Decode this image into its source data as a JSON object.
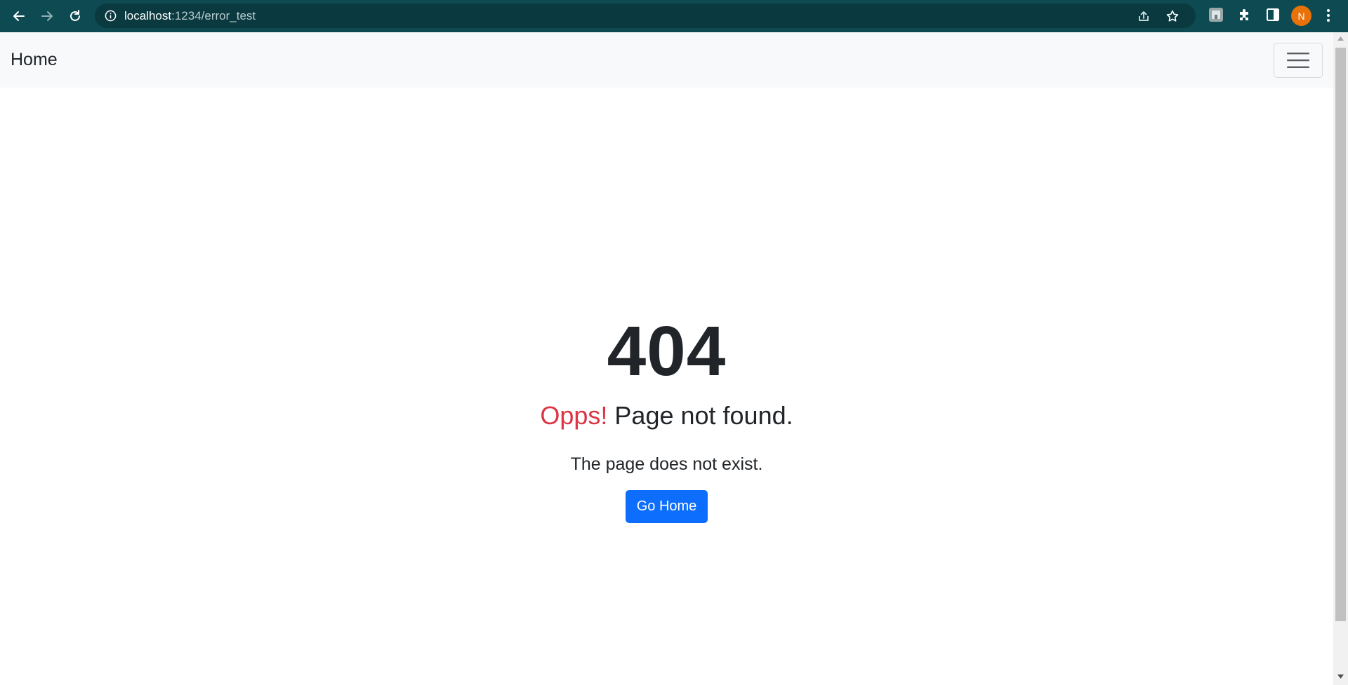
{
  "browser": {
    "url_host": "localhost",
    "url_path": ":1234/error_test",
    "avatar_initial": "N",
    "icons": {
      "back": "arrow-left-icon",
      "forward": "arrow-right-icon",
      "reload": "reload-icon",
      "site_info": "info-icon",
      "share": "share-icon",
      "bookmark": "star-icon",
      "extension": "puzzle-icon",
      "side_panel": "side-panel-icon",
      "menu": "kebab-menu-icon"
    },
    "colors": {
      "chrome_bg": "#0d4a52",
      "omnibox_bg": "#0a3a40",
      "avatar_bg": "#e8710a"
    }
  },
  "navbar": {
    "brand": "Home",
    "toggler_icon": "hamburger-icon",
    "bg_color": "#f8f9fa"
  },
  "error": {
    "code": "404",
    "headline_accent": "Opps!",
    "headline_rest": " Page not found.",
    "message": "The page does not exist.",
    "button_label": "Go Home",
    "accent_color": "#dc3545",
    "button_color": "#0d6efd"
  }
}
